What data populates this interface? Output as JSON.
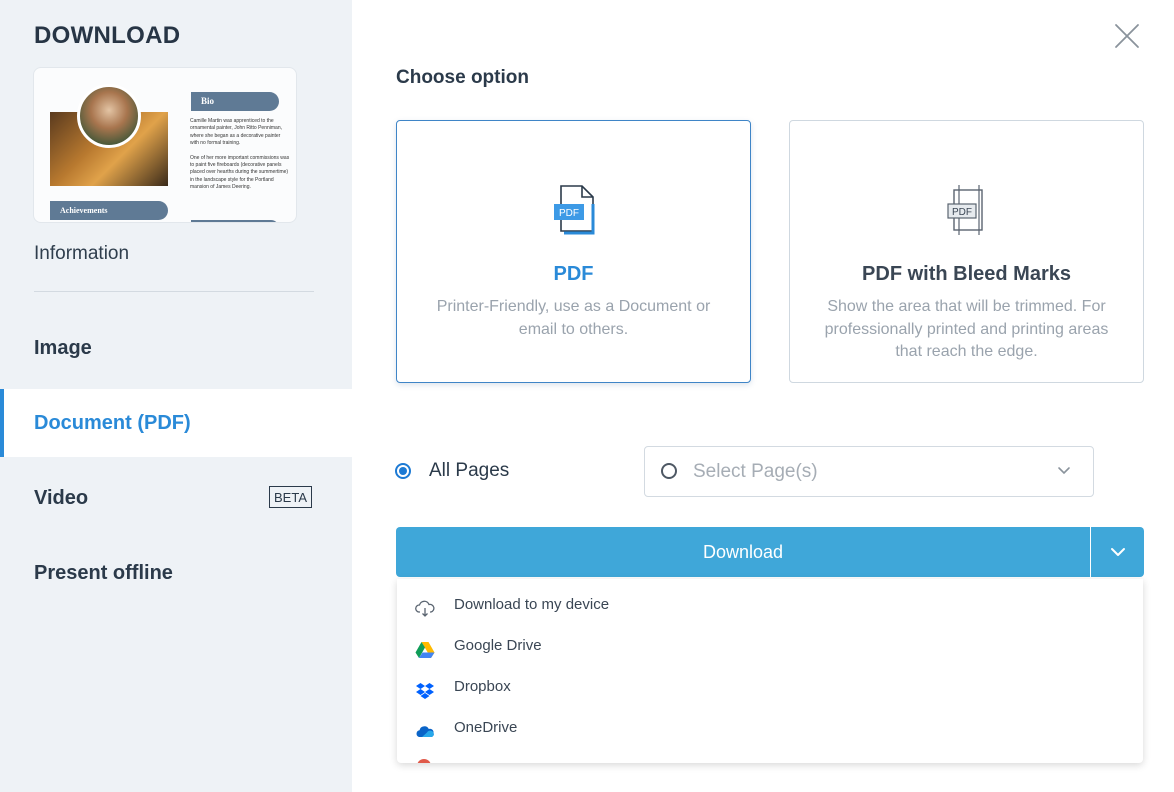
{
  "sidebar": {
    "title": "DOWNLOAD",
    "preview": {
      "bio_heading": "Bio",
      "bio_paragraph_1": "Camille Martin was apprenticed to the ornamental painter, John Ritto Penniman, where she began as a decorative painter with no formal training.",
      "bio_paragraph_2": "One of her more important commissions was to paint five fireboards (decorative panels placed over hearths during the summertime) in the landscape style for the Portland mansion of James Deering.",
      "achievements_heading": "Achievements"
    },
    "information_label": "Information",
    "items": [
      {
        "label": "Image",
        "active": false
      },
      {
        "label": "Document (PDF)",
        "active": true
      },
      {
        "label": "Video",
        "active": false,
        "badge": "BETA"
      },
      {
        "label": "Present offline",
        "active": false
      }
    ]
  },
  "main": {
    "heading": "Choose option",
    "options": [
      {
        "icon": "pdf-file-icon",
        "title": "PDF",
        "description": "Printer-Friendly, use as a Document or email to others.",
        "selected": true
      },
      {
        "icon": "pdf-bleed-marks-icon",
        "title": "PDF with Bleed Marks",
        "description": "Show the area that will be trimmed. For professionally printed and printing areas that reach the edge.",
        "selected": false
      }
    ],
    "pages": {
      "all_label": "All Pages",
      "all_selected": true,
      "select_placeholder": "Select Page(s)"
    },
    "download_label": "Download",
    "menu": [
      {
        "icon": "cloud-download-icon",
        "label": "Download to my device"
      },
      {
        "icon": "google-drive-icon",
        "label": "Google Drive"
      },
      {
        "icon": "dropbox-icon",
        "label": "Dropbox"
      },
      {
        "icon": "onedrive-icon",
        "label": "OneDrive"
      }
    ]
  },
  "colors": {
    "accent": "#2a8ad8",
    "button": "#3fa7d9",
    "sidebar_bg": "#eef2f6"
  }
}
